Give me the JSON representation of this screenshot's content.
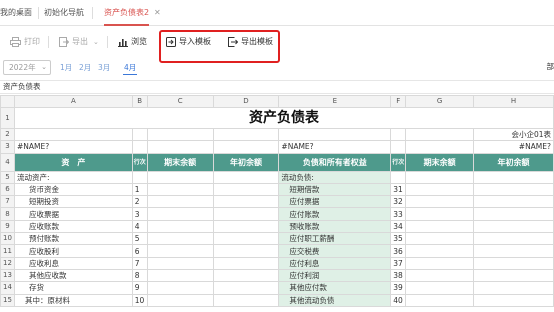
{
  "tabs": [
    {
      "label": "我的桌面",
      "active": false
    },
    {
      "label": "初始化导航",
      "active": false
    },
    {
      "label": "资产负债表2",
      "active": true
    }
  ],
  "toolbar": {
    "print": "打印",
    "export": "导出",
    "preview": "浏览",
    "import_template": "导入模板",
    "export_template": "导出模板"
  },
  "datebar": {
    "year": "2022年",
    "months": [
      "1月",
      "2月",
      "3月",
      "4月"
    ],
    "active_month": "4月",
    "right_text": "部"
  },
  "sheet": {
    "name": "资产负债表",
    "col_headers": [
      "A",
      "B",
      "C",
      "D",
      "E",
      "F",
      "G",
      "H"
    ],
    "row_numbers": [
      "1",
      "2",
      "3",
      "4",
      "5",
      "6",
      "7",
      "8",
      "9",
      "10",
      "11",
      "12",
      "13",
      "14",
      "15"
    ],
    "title": "资产负债表",
    "row2_h": "会小企01表",
    "row3_a": "#NAME?",
    "row3_e": "#NAME?",
    "row3_h": "#NAME?",
    "headers": {
      "asset": "资　产",
      "line_no": "行次",
      "end_balance": "期末余额",
      "begin_balance": "年初余额",
      "liab": "负债和所有者权益",
      "line_no2": "行次",
      "end_balance2": "期末余额",
      "begin_balance2": "年初余额"
    },
    "rows": [
      {
        "a": "流动资产:",
        "b": "",
        "e": "流动负债:",
        "f": ""
      },
      {
        "a": "货币资金",
        "b": "1",
        "e": "短期借款",
        "f": "31"
      },
      {
        "a": "短期投资",
        "b": "2",
        "e": "应付票据",
        "f": "32"
      },
      {
        "a": "应收票据",
        "b": "3",
        "e": "应付账款",
        "f": "33"
      },
      {
        "a": "应收账款",
        "b": "4",
        "e": "预收账款",
        "f": "34"
      },
      {
        "a": "预付账款",
        "b": "5",
        "e": "应付职工薪酬",
        "f": "35"
      },
      {
        "a": "应收股利",
        "b": "6",
        "e": "应交税费",
        "f": "36"
      },
      {
        "a": "应收利息",
        "b": "7",
        "e": "应付利息",
        "f": "37"
      },
      {
        "a": "其他应收款",
        "b": "8",
        "e": "应付利润",
        "f": "38"
      },
      {
        "a": "存货",
        "b": "9",
        "e": "其他应付款",
        "f": "39"
      },
      {
        "a": "其中：原材料",
        "b": "10",
        "e": "其他流动负债",
        "f": "40"
      }
    ]
  }
}
